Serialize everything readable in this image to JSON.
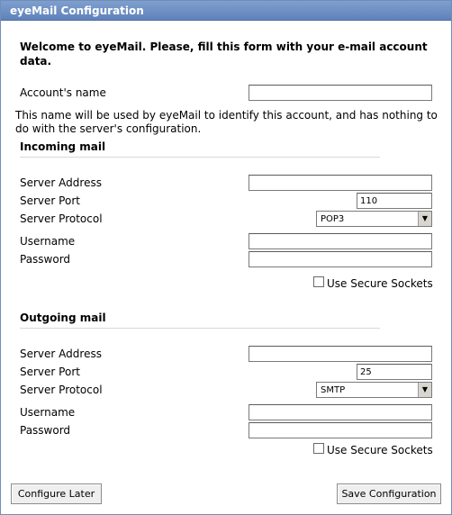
{
  "window": {
    "title": "eyeMail Configuration"
  },
  "intro": "Welcome to eyeMail. Please, fill this form with your e-mail account data.",
  "account": {
    "name_label": "Account's name",
    "name_value": "",
    "description": "This name will be used by eyeMail to identify this account, and has nothing to do with the server's configuration."
  },
  "incoming": {
    "heading": "Incoming mail",
    "server_address_label": "Server Address",
    "server_address_value": "",
    "server_port_label": "Server Port",
    "server_port_value": "110",
    "server_protocol_label": "Server Protocol",
    "server_protocol_value": "POP3",
    "username_label": "Username",
    "username_value": "",
    "password_label": "Password",
    "password_value": "",
    "secure_label": "Use Secure Sockets",
    "secure_checked": false
  },
  "outgoing": {
    "heading": "Outgoing mail",
    "server_address_label": "Server Address",
    "server_address_value": "",
    "server_port_label": "Server Port",
    "server_port_value": "25",
    "server_protocol_label": "Server Protocol",
    "server_protocol_value": "SMTP",
    "username_label": "Username",
    "username_value": "",
    "password_label": "Password",
    "password_value": "",
    "secure_label": "Use Secure Sockets",
    "secure_checked": false
  },
  "buttons": {
    "configure_later": "Configure Later",
    "save": "Save Configuration"
  },
  "icons": {
    "dropdown_arrow": "chevron-down-icon"
  },
  "colors": {
    "titlebar": "#6a8cc3",
    "window_border": "#6f8fb8"
  }
}
